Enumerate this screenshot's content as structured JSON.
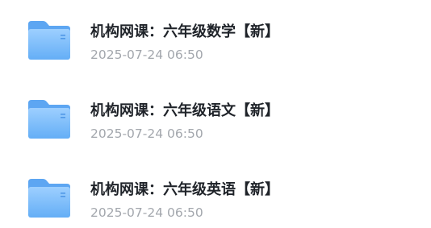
{
  "files": [
    {
      "icon": "folder-icon",
      "name": "机构网课：六年级数学【新】",
      "time": "2025-07-24 06:50"
    },
    {
      "icon": "folder-icon",
      "name": "机构网课：六年级语文【新】",
      "time": "2025-07-24 06:50"
    },
    {
      "icon": "folder-icon",
      "name": "机构网课：六年级英语【新】",
      "time": "2025-07-24 06:50"
    }
  ],
  "colors": {
    "folder_light": "#8fc6fb",
    "folder_dark": "#5aa7f4",
    "title_text": "#1f2329",
    "time_text": "#a3a7ad"
  }
}
